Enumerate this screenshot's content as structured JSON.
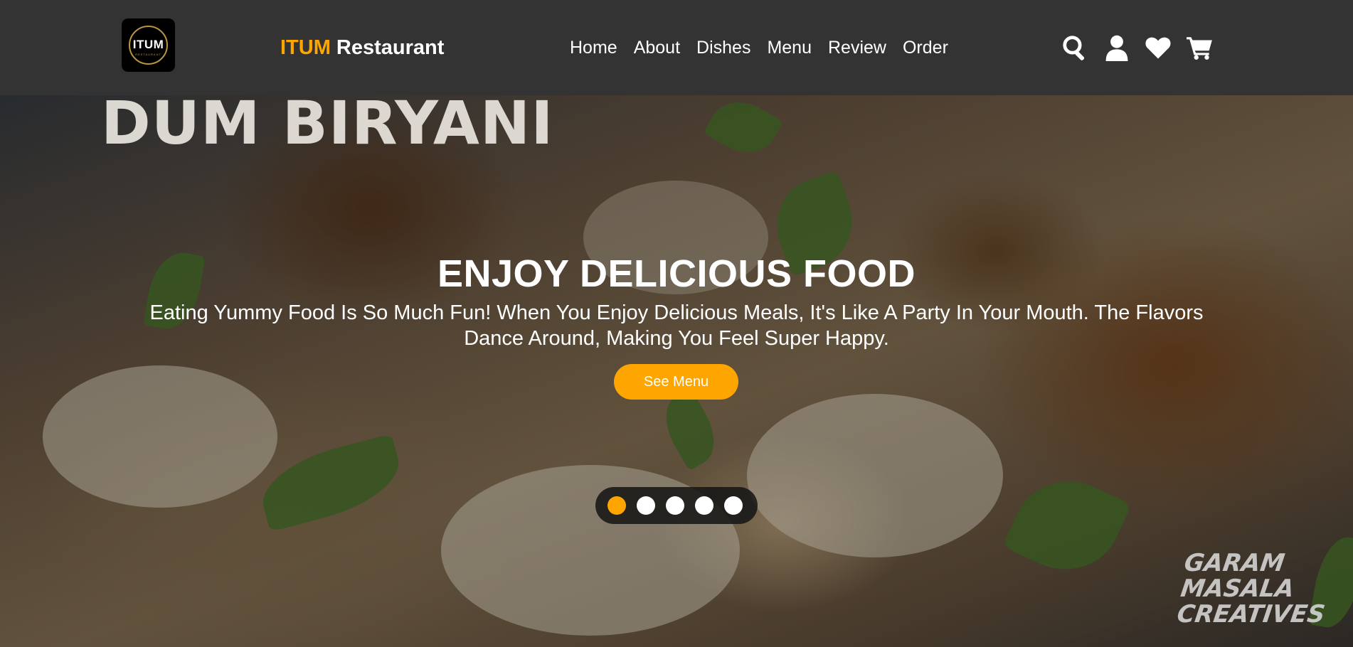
{
  "nav": {
    "logo_text": "ITUM",
    "logo_sub": "RESTAURANT",
    "brand_accent": "ITUM",
    "brand_rest": " Restaurant",
    "links": [
      "Home",
      "About",
      "Dishes",
      "Menu",
      "Review",
      "Order"
    ],
    "icons": [
      "search-icon",
      "user-icon",
      "heart-icon",
      "cart-icon"
    ]
  },
  "hero": {
    "dish_caption": "DUM BIRYANI",
    "watermark": "GARAM MASALA CREATIVES",
    "title": "ENJOY DELICIOUS FOOD",
    "text": "Eating Yummy Food Is So Much Fun! When You Enjoy Delicious Meals, It's Like A Party In Your Mouth. The Flavors Dance Around, Making You Feel Super Happy.",
    "button_label": "See Menu",
    "slides_count": 5,
    "active_slide": 1
  },
  "colors": {
    "accent": "#ffa500",
    "navbar": "#333333",
    "text": "#ffffff"
  }
}
